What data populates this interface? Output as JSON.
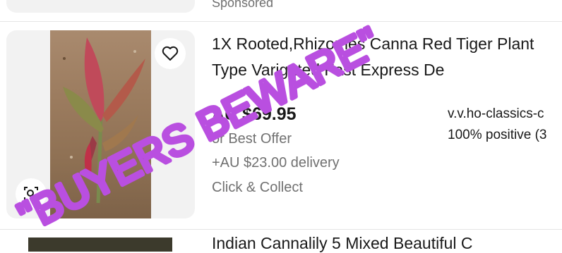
{
  "previous_item": {
    "sponsored_label": "Sponsored"
  },
  "listing": {
    "title_line1": "1X Rooted,Rhizomes Canna Red Tiger Plant",
    "title_line2": "Type Varigated Fast Express De",
    "price": "AU $69.95",
    "best_offer": "or Best Offer",
    "delivery": "+AU $23.00 delivery",
    "collect": "Click & Collect",
    "seller": "v.v.ho-classics-c",
    "feedback": "100% positive (3",
    "icons": {
      "favorite": "heart-icon",
      "zoom": "zoom-image-icon"
    }
  },
  "next_item": {
    "title": "Indian Cannalily 5 Mixed Beautiful C"
  },
  "watermark": {
    "text": "\"BUYERS BEWARE\"",
    "color": "#b94fe0"
  }
}
